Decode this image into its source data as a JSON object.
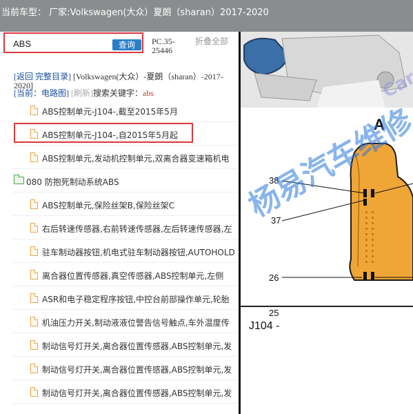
{
  "title_bar": {
    "text": "当前车型：  厂家:Volkswagen(大众）夏朗（sharan）2017-2020"
  },
  "search": {
    "value": "ABS",
    "button_label": "查询",
    "pc_code": "PC.35-25446",
    "collapse_label": "折叠全部"
  },
  "breadcrumb": {
    "back": "[返回",
    "full_catalog": "完整目录]",
    "vehicle": "[Volkswagen(大众）-夏朗（sharan）-2017-2020]",
    "current_label": "[当前：",
    "current_value": "电路图]",
    "refresh": "[刷新]",
    "keyword_label": "搜索关键字：",
    "keyword": "abs"
  },
  "items": [
    {
      "type": "file",
      "label": "ABS控制单元-J104-,截至2015年5月"
    },
    {
      "type": "file",
      "label": "ABS控制单元-J104-,自2015年5月起"
    },
    {
      "type": "file",
      "label": "ABS控制单元,发动机控制单元,双离合器变速箱机电"
    },
    {
      "type": "folder",
      "label": "080 防抱死制动系统ABS"
    },
    {
      "type": "file",
      "label": "ABS控制单元,保险丝架B,保险丝架C"
    },
    {
      "type": "file",
      "label": "右后转速传感器,右前转速传感器,左后转速传感器,左"
    },
    {
      "type": "file",
      "label": "驻车制动器按钮,机电式驻车制动器按钮,AUTOHOLD"
    },
    {
      "type": "file",
      "label": "离合器位置传感器,真空传感器,ABS控制单元,左侧"
    },
    {
      "type": "file",
      "label": "ASR和电子稳定程序按钮,中控台前部操作单元,轮胎"
    },
    {
      "type": "file",
      "label": "机油压力开关,制动液液位警告信号触点,车外温度传"
    },
    {
      "type": "file",
      "label": "制动信号灯开关,离合器位置传感器,ABS控制单元,发"
    },
    {
      "type": "file",
      "label": "制动信号灯开关,离合器位置传感器,ABS控制单元,发"
    },
    {
      "type": "file",
      "label": "制动信号灯开关,离合器位置传感器,ABS控制单元,发"
    }
  ],
  "diagram": {
    "connector_label": "A",
    "pins": [
      "38",
      "37",
      "26",
      "25"
    ],
    "component_label": "J104  -",
    "watermark_text": "杨易汽车维修",
    "watermark_small": "Car"
  },
  "colors": {
    "title_bg": "#8a8c8e",
    "highlight_border": "#d9383d",
    "button_blue": "#2a7ec8",
    "link_blue": "#1d4fa0",
    "connector_orange": "#f0a537",
    "watermark_blue": "#2878dc"
  }
}
